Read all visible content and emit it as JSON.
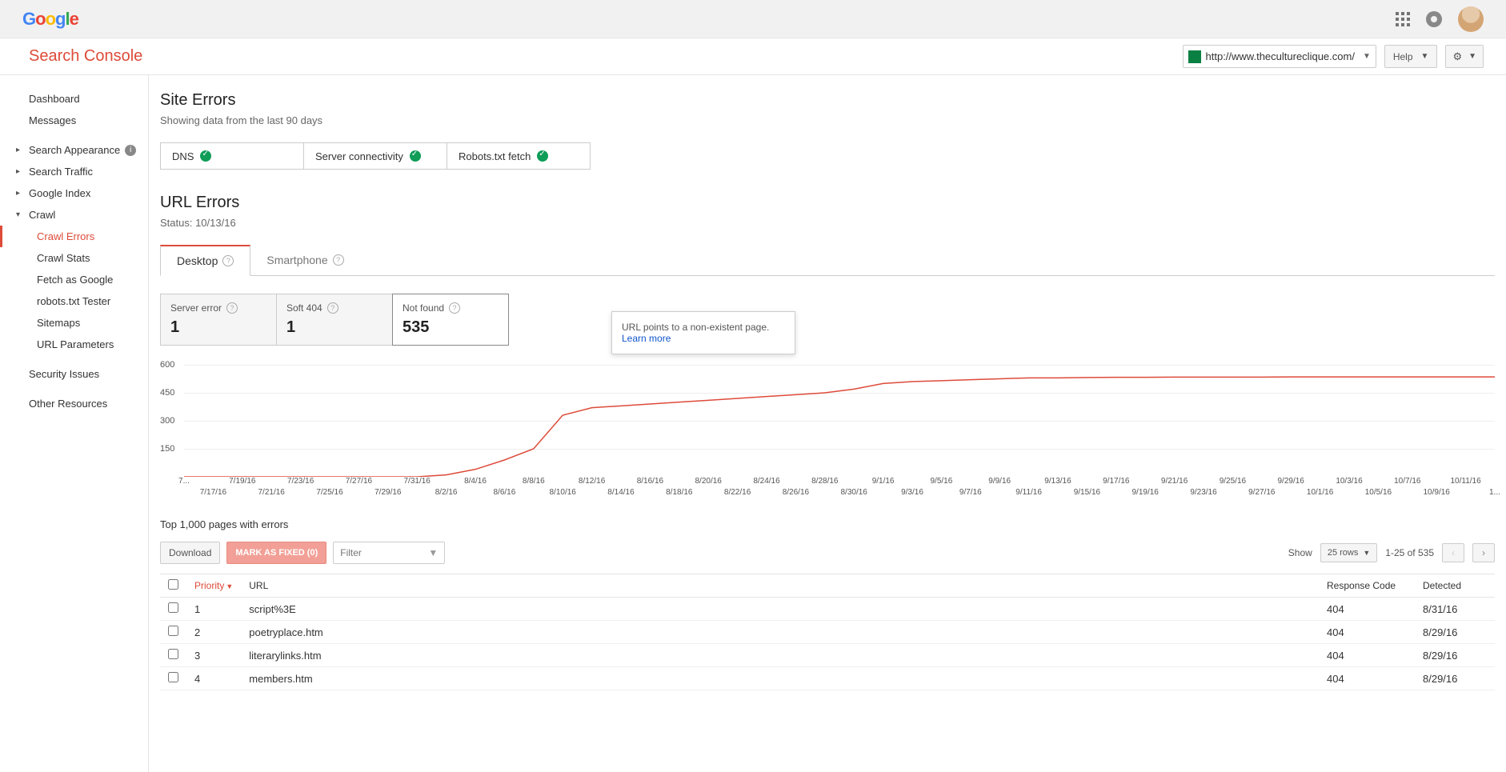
{
  "header": {
    "app_title": "Search Console",
    "site_url": "http://www.thecultureclique.com/",
    "help_label": "Help"
  },
  "sidebar": {
    "dashboard": "Dashboard",
    "messages": "Messages",
    "search_appearance": "Search Appearance",
    "search_traffic": "Search Traffic",
    "google_index": "Google Index",
    "crawl": "Crawl",
    "crawl_children": {
      "crawl_errors": "Crawl Errors",
      "crawl_stats": "Crawl Stats",
      "fetch_as_google": "Fetch as Google",
      "robots_txt_tester": "robots.txt Tester",
      "sitemaps": "Sitemaps",
      "url_parameters": "URL Parameters"
    },
    "security_issues": "Security Issues",
    "other_resources": "Other Resources"
  },
  "site_errors": {
    "title": "Site Errors",
    "subtitle": "Showing data from the last 90 days",
    "statuses": {
      "dns": "DNS",
      "server": "Server connectivity",
      "robots": "Robots.txt fetch"
    }
  },
  "url_errors": {
    "title": "URL Errors",
    "status": "Status: 10/13/16",
    "tabs": {
      "desktop": "Desktop",
      "smartphone": "Smartphone"
    },
    "metrics": {
      "server_error": {
        "label": "Server error",
        "value": "1"
      },
      "soft_404": {
        "label": "Soft 404",
        "value": "1"
      },
      "not_found": {
        "label": "Not found",
        "value": "535"
      }
    },
    "tooltip_text": "URL points to a non-existent page. ",
    "tooltip_link": "Learn more"
  },
  "chart_data": {
    "type": "line",
    "title": "",
    "xlabel": "",
    "ylabel": "",
    "ylim": [
      0,
      600
    ],
    "y_ticks": [
      150,
      300,
      450,
      600
    ],
    "x_ticks_upper": [
      "7...",
      "7/19/16",
      "7/23/16",
      "7/27/16",
      "7/31/16",
      "8/4/16",
      "8/8/16",
      "8/12/16",
      "8/16/16",
      "8/20/16",
      "8/24/16",
      "8/28/16",
      "9/1/16",
      "9/5/16",
      "9/9/16",
      "9/13/16",
      "9/17/16",
      "9/21/16",
      "9/25/16",
      "9/29/16",
      "10/3/16",
      "10/7/16",
      "10/11/16"
    ],
    "x_ticks_lower": [
      "7/17/16",
      "7/21/16",
      "7/25/16",
      "7/29/16",
      "8/2/16",
      "8/6/16",
      "8/10/16",
      "8/14/16",
      "8/18/16",
      "8/22/16",
      "8/26/16",
      "8/30/16",
      "9/3/16",
      "9/7/16",
      "9/11/16",
      "9/15/16",
      "9/19/16",
      "9/23/16",
      "9/27/16",
      "10/1/16",
      "10/5/16",
      "10/9/16",
      "1..."
    ],
    "series": [
      {
        "name": "Not found",
        "color": "#dd4b39",
        "x": [
          0,
          1,
          2,
          3,
          4,
          5,
          6,
          7,
          8,
          9,
          10,
          11,
          12,
          13,
          14,
          15,
          16,
          17,
          18,
          19,
          20,
          21,
          22,
          23,
          24,
          25,
          26,
          27,
          28,
          29,
          30,
          31,
          32,
          33,
          34,
          35,
          36,
          37,
          38,
          39,
          40,
          41,
          42,
          43,
          44,
          45
        ],
        "values": [
          0,
          0,
          0,
          0,
          0,
          0,
          0,
          0,
          0,
          10,
          40,
          90,
          150,
          330,
          370,
          380,
          390,
          400,
          410,
          420,
          430,
          440,
          450,
          470,
          500,
          510,
          515,
          520,
          525,
          530,
          530,
          532,
          533,
          533,
          534,
          534,
          534,
          534,
          535,
          535,
          535,
          535,
          535,
          535,
          535,
          535
        ]
      }
    ]
  },
  "table": {
    "title": "Top 1,000 pages with errors",
    "download": "Download",
    "mark_fixed": "MARK AS FIXED (0)",
    "filter_placeholder": "Filter",
    "show_label": "Show",
    "rows_label": "25 rows",
    "range_label": "1-25 of 535",
    "headers": {
      "priority": "Priority",
      "url": "URL",
      "response": "Response Code",
      "detected": "Detected"
    },
    "rows": [
      {
        "priority": "1",
        "url": "script%3E",
        "response": "404",
        "detected": "8/31/16"
      },
      {
        "priority": "2",
        "url": "poetryplace.htm",
        "response": "404",
        "detected": "8/29/16"
      },
      {
        "priority": "3",
        "url": "literarylinks.htm",
        "response": "404",
        "detected": "8/29/16"
      },
      {
        "priority": "4",
        "url": "members.htm",
        "response": "404",
        "detected": "8/29/16"
      }
    ]
  }
}
